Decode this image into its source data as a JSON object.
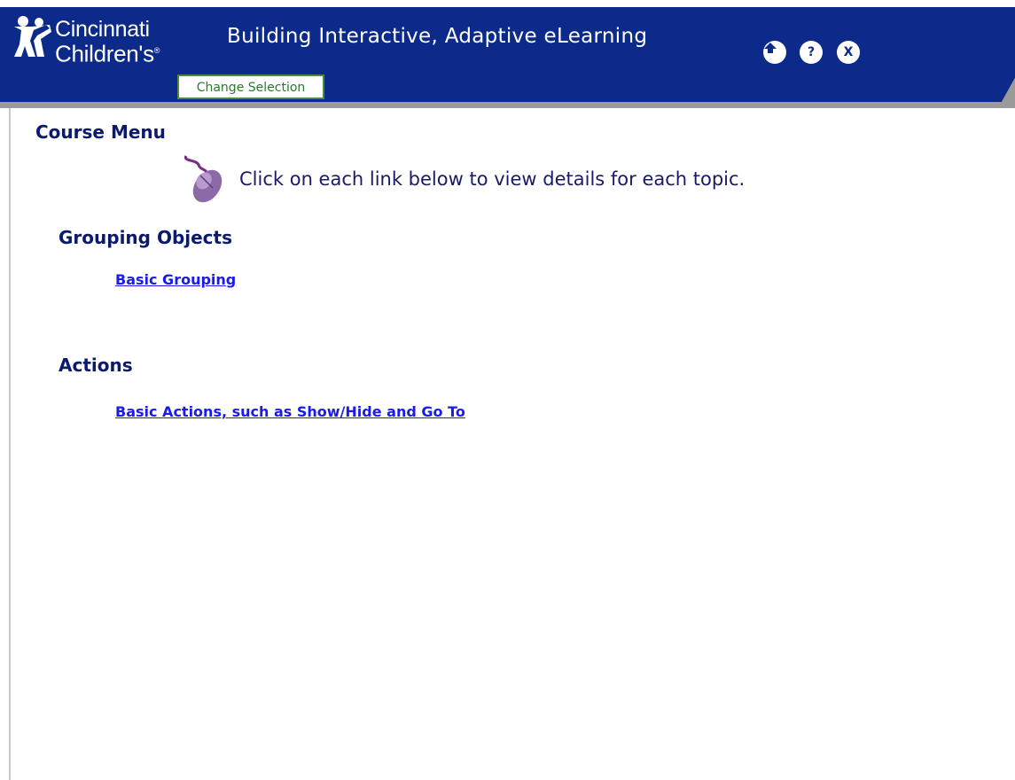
{
  "header": {
    "logo": {
      "line1": "Cincinnati",
      "line2": "Children's"
    },
    "title": "Building Interactive, Adaptive eLearning",
    "nav": {
      "home": "⌂",
      "help": "?",
      "exit": "X"
    },
    "change_selection": "Change Selection",
    "brand_color": "#0b2a8a"
  },
  "main": {
    "heading": "Course Menu",
    "instruction_icon": "mouse-icon",
    "instruction": "Click on each link below to view details for each topic.",
    "sections": [
      {
        "heading": "Grouping Objects",
        "links": [
          "Basic Grouping"
        ]
      },
      {
        "heading": "Actions",
        "links": [
          "Basic Actions, such as Show/Hide and Go To"
        ]
      }
    ]
  }
}
